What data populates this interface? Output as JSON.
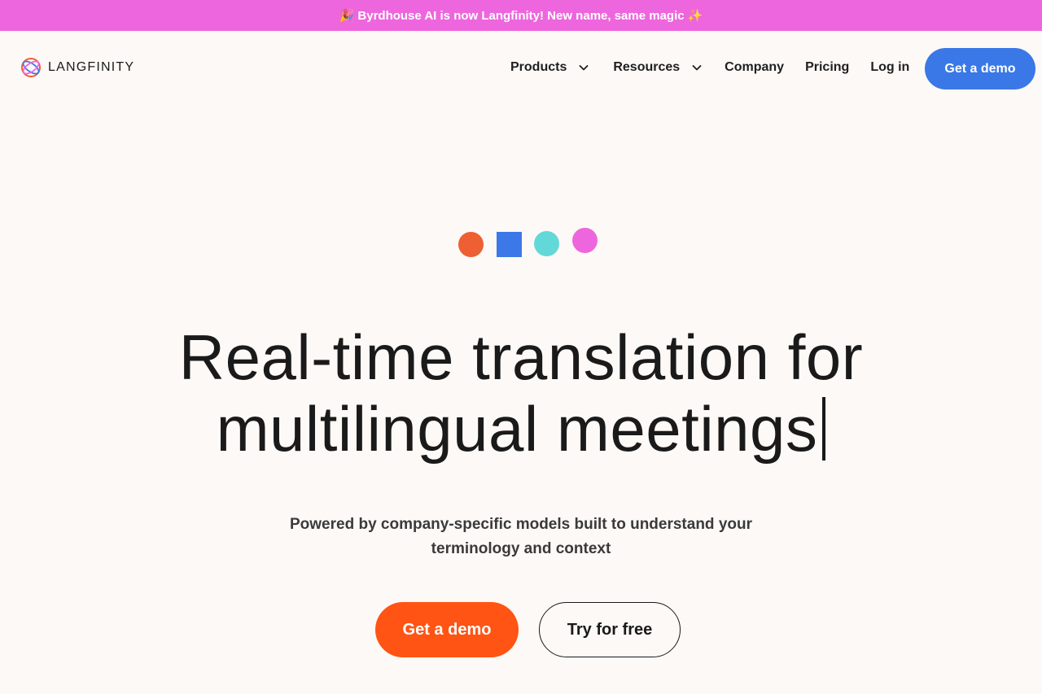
{
  "banner": {
    "text": "🎉 Byrdhouse AI is now Langfinity! New name, same magic ✨",
    "background": "#ee66dd"
  },
  "nav": {
    "logo_text": "LANGFINITY",
    "items": [
      {
        "label": "Products",
        "has_dropdown": true
      },
      {
        "label": "Resources",
        "has_dropdown": true
      },
      {
        "label": "Company",
        "has_dropdown": false
      },
      {
        "label": "Pricing",
        "has_dropdown": false
      },
      {
        "label": "Log in",
        "has_dropdown": false
      }
    ],
    "cta_label": "Get a demo",
    "cta_color": "#3b78e7"
  },
  "hero": {
    "shapes": [
      {
        "name": "orange-circle",
        "color": "#ee5f33"
      },
      {
        "name": "blue-square",
        "color": "#3d78e8"
      },
      {
        "name": "teal-circle",
        "color": "#63d8d8"
      },
      {
        "name": "pink-circle",
        "color": "#ee66dd"
      }
    ],
    "headline_line1": "Real-time translation for",
    "headline_line2": "multilingual meetings",
    "subtitle_line1": "Powered by company-specific models built to understand your",
    "subtitle_line2": "terminology and context",
    "primary_cta": "Get a demo",
    "primary_cta_color": "#ff5414",
    "secondary_cta": "Try for free"
  },
  "colors": {
    "page_background": "#fdf9f6",
    "text": "#1a1a1a"
  }
}
